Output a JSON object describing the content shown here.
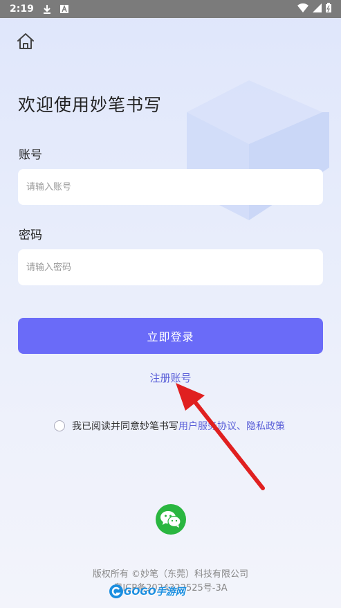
{
  "status_bar": {
    "time": "2:19",
    "icons": [
      "download-icon",
      "text-a-icon",
      "wifi-icon",
      "signal-icon",
      "battery-icon"
    ]
  },
  "home": {
    "icon": "home-icon"
  },
  "welcome_title": "欢迎使用妙笔书写",
  "account": {
    "label": "账号",
    "placeholder": "请输入账号",
    "value": ""
  },
  "password": {
    "label": "密码",
    "placeholder": "请输入密码",
    "value": ""
  },
  "login_button": "立即登录",
  "register_link": "注册账号",
  "agreement": {
    "prefix": "我已阅读并同意妙笔书写",
    "terms": "用户服务协议",
    "separator": "、",
    "privacy": "隐私政策",
    "checked": false
  },
  "wechat": {
    "icon": "wechat-icon"
  },
  "footer": {
    "copyright": "版权所有 ©妙笔（东莞）科技有限公司",
    "icp": "粤ICP备2024322525号-3A"
  },
  "watermark": {
    "text": "GOGO手游网"
  },
  "colors": {
    "primary": "#6a6bf8",
    "link": "#5a5fd8",
    "wechat": "#2ab640",
    "annotation_arrow": "#e02020"
  }
}
